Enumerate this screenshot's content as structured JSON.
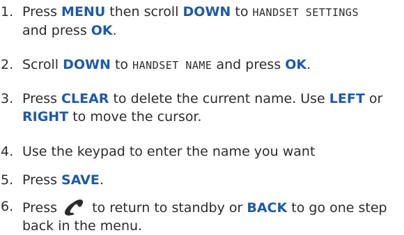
{
  "steps": [
    {
      "number": "1.",
      "line1": {
        "t1": "Press ",
        "k1": "MENU",
        "t2": " then scroll ",
        "k2": "DOWN",
        "t3": " to ",
        "lcd": "HANDSET SETTINGS"
      },
      "line2": {
        "t1": "and press ",
        "k1": "OK",
        "t2": "."
      }
    },
    {
      "number": "2.",
      "line1": {
        "t1": "Scroll ",
        "k1": "DOWN",
        "t2": " to ",
        "lcd": "HANDSET NAME",
        "t3": " and press ",
        "k2": "OK",
        "t4": "."
      }
    },
    {
      "number": "3.",
      "line1": {
        "t1": "Press ",
        "k1": "CLEAR",
        "t2": " to delete the current name. Use ",
        "k2": "LEFT",
        "t3": " or"
      },
      "line2": {
        "k1": "RIGHT",
        "t1": " to move the cursor."
      }
    },
    {
      "number": "4.",
      "line1": {
        "t1": "Use the keypad to enter the name you want"
      }
    },
    {
      "number": "5.",
      "line1": {
        "t1": "Press ",
        "k1": "SAVE",
        "t2": "."
      }
    },
    {
      "number": "6.",
      "line1": {
        "t1": "Press ",
        "icon": "end-call-phone-icon",
        "t2": " to return to standby or ",
        "k1": "BACK",
        "t3": " to go one step"
      },
      "line2": {
        "t1": "back in the menu."
      }
    }
  ],
  "colors": {
    "keyword": "#1f5aa6",
    "text": "#2b2b2b"
  }
}
